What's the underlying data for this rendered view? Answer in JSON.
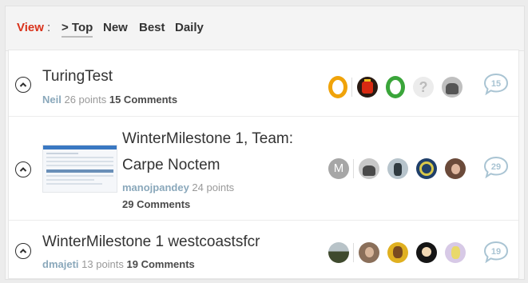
{
  "view_bar": {
    "label": "View",
    "colon": ":",
    "tabs": [
      {
        "label": "> Top",
        "active": true
      },
      {
        "label": "New",
        "active": false
      },
      {
        "label": "Best",
        "active": false
      },
      {
        "label": "Daily",
        "active": false
      }
    ]
  },
  "posts": [
    {
      "title": "TuringTest",
      "author": "Neil",
      "points": "26 points",
      "comments": "15 Comments",
      "comment_count": "15",
      "has_thumbnail": false,
      "avatars": [
        "orange-ring-avatar",
        "red-lantern-avatar",
        "green-ring-avatar",
        "question-mark-avatar",
        "photo-avatar"
      ]
    },
    {
      "title_line1": "WinterMilestone 1, Team:",
      "title_line2": "Carpe Noctem",
      "author": "manojpandey",
      "points": "24 points",
      "comments": "29 Comments",
      "comment_count": "29",
      "has_thumbnail": true,
      "avatars": [
        "letter-m-avatar",
        "photo-avatar",
        "photo-avatar",
        "blue-pattern-avatar",
        "photo-avatar"
      ],
      "initial": "M"
    },
    {
      "title": "WinterMilestone 1 westcoastsfcr",
      "author": "dmajeti",
      "points": "13 points",
      "comments": "19 Comments",
      "comment_count": "19",
      "has_thumbnail": false,
      "avatars": [
        "landscape-avatar",
        "photo-avatar",
        "yellow-avatar",
        "cartoon-avatar",
        "purple-avatar"
      ]
    }
  ],
  "colors": {
    "view_label": "#d9321b",
    "author": "#8aa8bb",
    "bubble": "#a9c4d3",
    "orange": "#f0a30a",
    "green": "#3aa53a"
  }
}
